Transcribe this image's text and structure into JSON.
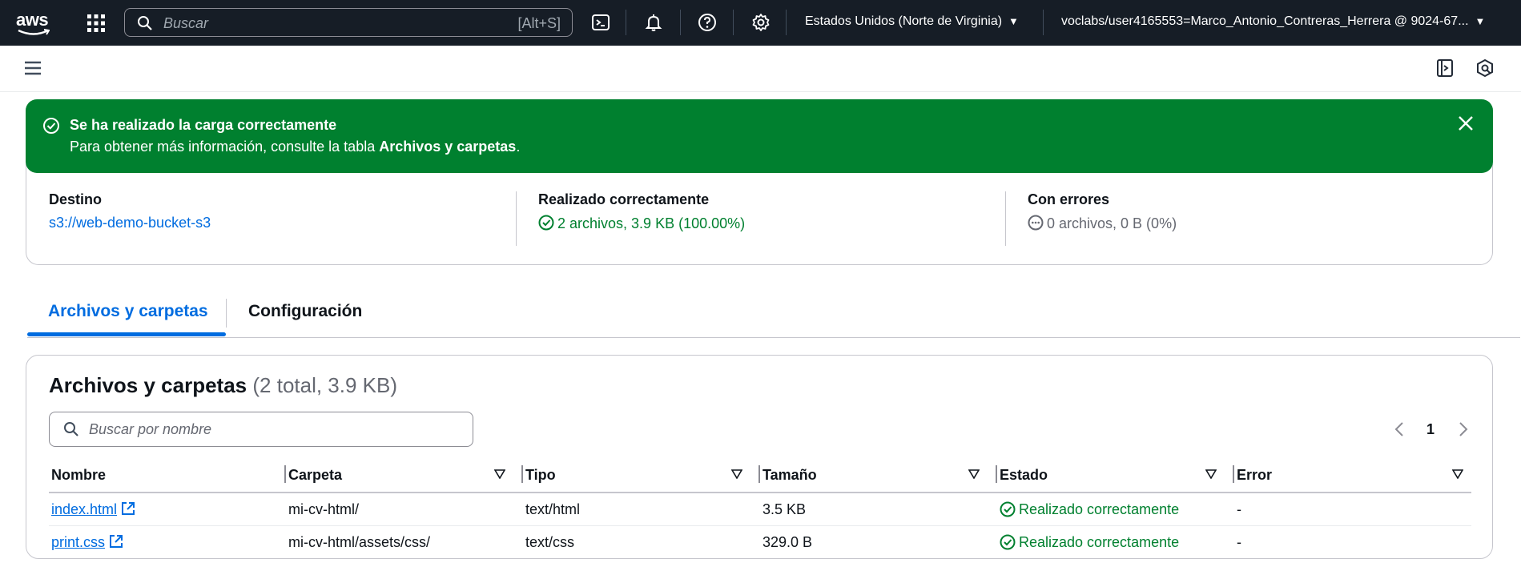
{
  "topnav": {
    "logo": "aws",
    "search_placeholder": "Buscar",
    "search_shortcut": "[Alt+S]",
    "region": "Estados Unidos (Norte de Virginia)",
    "account": "voclabs/user4165553=Marco_Antonio_Contreras_Herrera @ 9024-67..."
  },
  "flash": {
    "title": "Se ha realizado la carga correctamente",
    "message_prefix": "Para obtener más información, consulte la tabla ",
    "message_bold": "Archivos y carpetas",
    "message_suffix": "."
  },
  "summary": {
    "destination_label": "Destino",
    "destination_value": "s3://web-demo-bucket-s3",
    "success_label": "Realizado correctamente",
    "success_value": "2 archivos, 3.9 KB (100.00%)",
    "errors_label": "Con errores",
    "errors_value": "0 archivos, 0 B (0%)"
  },
  "tabs": [
    {
      "label": "Archivos y carpetas",
      "active": true
    },
    {
      "label": "Configuración",
      "active": false
    }
  ],
  "files": {
    "heading": "Archivos y carpetas",
    "count": "(2 total, 3.9 KB)",
    "filter_placeholder": "Buscar por nombre",
    "page": "1",
    "columns": [
      "Nombre",
      "Carpeta",
      "Tipo",
      "Tamaño",
      "Estado",
      "Error"
    ],
    "rows": [
      {
        "name": "index.html",
        "folder": "mi-cv-html/",
        "type": "text/html",
        "size": "3.5 KB",
        "status": "Realizado correctamente",
        "error": "-"
      },
      {
        "name": "print.css",
        "folder": "mi-cv-html/assets/css/",
        "type": "text/css",
        "size": "329.0 B",
        "status": "Realizado correctamente",
        "error": "-"
      }
    ]
  },
  "colors": {
    "nav_bg": "#161d26",
    "success_green": "#00802f",
    "link_blue": "#006ce0"
  }
}
